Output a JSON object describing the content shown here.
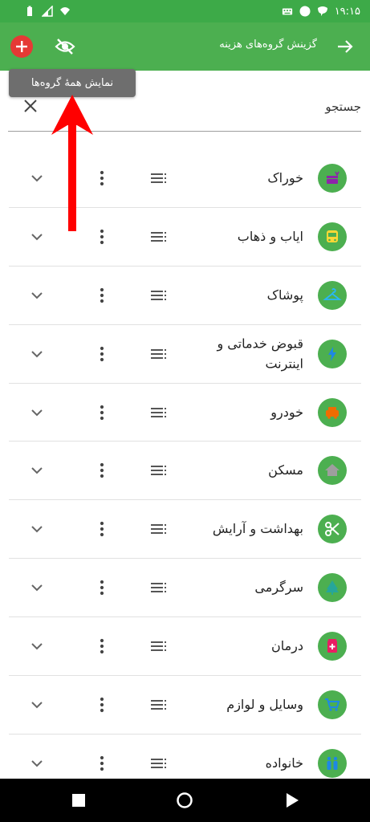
{
  "status_bar": {
    "time": "۱۹:۱۵",
    "icons": [
      "battery-icon",
      "signal-icon",
      "wifi-icon",
      "keyboard-icon",
      "circle-notification-icon",
      "chat-icon"
    ]
  },
  "app_bar": {
    "title": "گزینش گروه‌های هزینه",
    "accent_color": "#4caf50",
    "add_color": "#e53935"
  },
  "tooltip": {
    "text": "نمایش همهٔ گروه‌ها"
  },
  "search": {
    "label": "جستجو"
  },
  "annotation": {
    "arrow_color": "#ff0000"
  },
  "categories": [
    {
      "label": "خوراک",
      "icon": "food-icon",
      "icon_color": "#8e24aa"
    },
    {
      "label": "ایاب و ذهاب",
      "icon": "bus-icon",
      "icon_color": "#fdd835"
    },
    {
      "label": "پوشاک",
      "icon": "hanger-icon",
      "icon_color": "#29b6f6"
    },
    {
      "label": "قبوض خدماتی و اینترنت",
      "icon": "lightning-icon",
      "icon_color": "#1e88e5"
    },
    {
      "label": "خودرو",
      "icon": "car-icon",
      "icon_color": "#ef6c00"
    },
    {
      "label": "مسکن",
      "icon": "home-icon",
      "icon_color": "#9e9e9e"
    },
    {
      "label": "بهداشت و آرایش",
      "icon": "scissors-icon",
      "icon_color": "#ffffff"
    },
    {
      "label": "سرگرمی",
      "icon": "tree-icon",
      "icon_color": "#26a69a"
    },
    {
      "label": "درمان",
      "icon": "medicine-icon",
      "icon_color": "#e91e63"
    },
    {
      "label": "وسایل و لوازم",
      "icon": "cart-icon",
      "icon_color": "#1e88e5"
    },
    {
      "label": "خانواده",
      "icon": "family-icon",
      "icon_color": "#1e88e5"
    }
  ]
}
